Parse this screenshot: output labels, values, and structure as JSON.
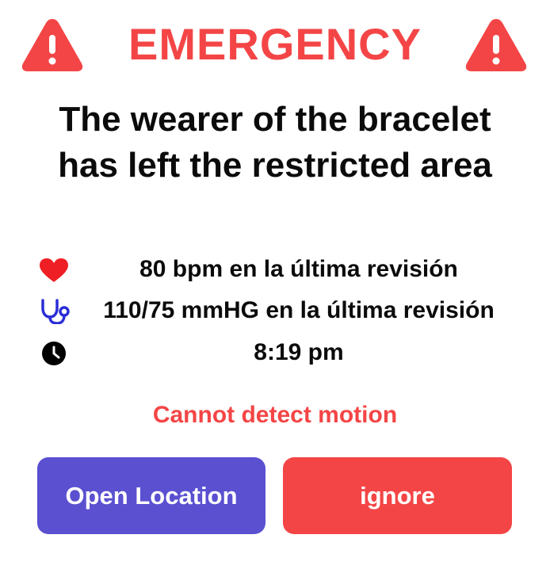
{
  "colors": {
    "alert": "#f44546",
    "primary": "#5a50d0",
    "heart": "#ee1f25",
    "stethoscope": "#2a2ed6",
    "clock": "#000000"
  },
  "header": {
    "title": "EMERGENCY",
    "left_icon": "warning-triangle-icon",
    "right_icon": "warning-triangle-icon"
  },
  "alert": {
    "message": "The wearer of the bracelet has left the restricted area"
  },
  "vitals": [
    {
      "icon": "heart-icon",
      "text": "80 bpm en la última revisión"
    },
    {
      "icon": "stethoscope-icon",
      "text": "110/75 mmHG en la última revisión"
    },
    {
      "icon": "clock-icon",
      "text": "8:19 pm"
    }
  ],
  "status": {
    "text": "Cannot detect motion"
  },
  "actions": {
    "open_location": "Open Location",
    "ignore": "ignore"
  }
}
